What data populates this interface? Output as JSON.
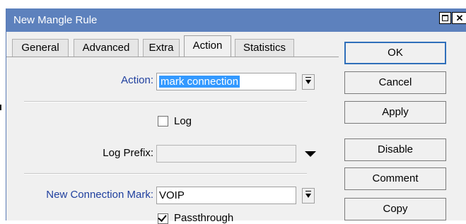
{
  "window": {
    "title": "New Mangle Rule",
    "maximize_icon": "maximize-icon",
    "close_icon": "close-icon"
  },
  "tabs": [
    {
      "label": "General",
      "active": false
    },
    {
      "label": "Advanced",
      "active": false
    },
    {
      "label": "Extra",
      "active": false
    },
    {
      "label": "Action",
      "active": true
    },
    {
      "label": "Statistics",
      "active": false
    }
  ],
  "form": {
    "action_label": "Action:",
    "action_value": "mark connection",
    "log_label": "Log",
    "log_checked": false,
    "log_prefix_label": "Log Prefix:",
    "log_prefix_value": "",
    "new_connection_mark_label": "New Connection Mark:",
    "new_connection_mark_value": "VOIP",
    "passthrough_label": "Passthrough",
    "passthrough_checked": true
  },
  "buttons": {
    "ok": "OK",
    "cancel": "Cancel",
    "apply": "Apply",
    "disable": "Disable",
    "comment": "Comment",
    "copy": "Copy"
  },
  "colors": {
    "titlebar": "#5d81bd",
    "label_blue": "#1f3f9e",
    "selection": "#3399ff"
  }
}
